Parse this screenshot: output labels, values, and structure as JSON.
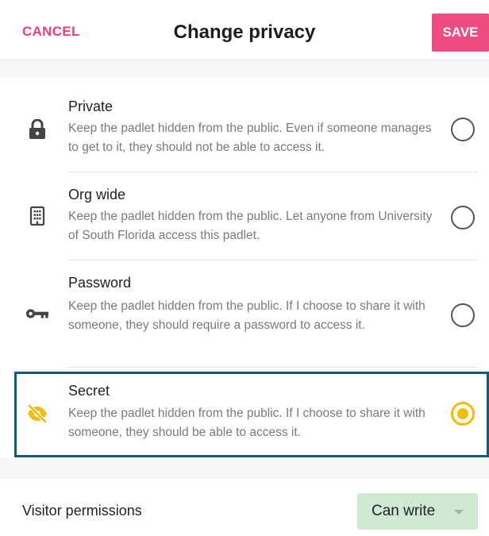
{
  "header": {
    "cancel_label": "CANCEL",
    "title": "Change privacy",
    "save_label": "SAVE"
  },
  "options": [
    {
      "icon": "lock-icon",
      "title": "Private",
      "description": "Keep the padlet hidden from the public. Even if someone manages to get to it, they should not be able to access it.",
      "selected": false
    },
    {
      "icon": "building-icon",
      "title": "Org wide",
      "description": "Keep the padlet hidden from the public. Let anyone from University of South Florida access this padlet.",
      "selected": false
    },
    {
      "icon": "key-icon",
      "title": "Password",
      "description": "Keep the padlet hidden from the public. If I choose to share it with someone, they should require a password to access it.",
      "selected": false
    },
    {
      "icon": "eye-slash-icon",
      "title": "Secret",
      "description": "Keep the padlet hidden from the public. If I choose to share it with someone, they should be able to access it.",
      "selected": true
    }
  ],
  "visitor_permissions": {
    "label": "Visitor permissions",
    "value": "Can write"
  },
  "colors": {
    "accent_pink": "#ee4b80",
    "selected_yellow": "#f4bd00",
    "focus_border": "#155a6e",
    "permission_bg": "#cfe9d2"
  }
}
